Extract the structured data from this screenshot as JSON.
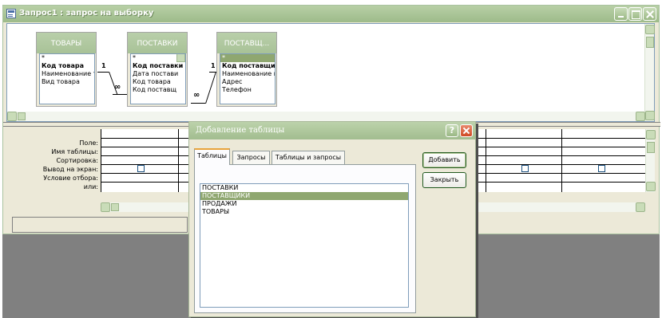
{
  "window": {
    "title": "Запрос1 : запрос на выборку"
  },
  "field_lists": [
    {
      "title": "ТОВАРЫ",
      "fields": [
        "*",
        "Код товара",
        "Наименование т",
        "Вид товара"
      ]
    },
    {
      "title": "ПОСТАВКИ",
      "fields": [
        "*",
        "Код поставки",
        "Дата постави",
        "Код товара",
        "Код поставщ"
      ]
    },
    {
      "title": "ПОСТАВЩ...",
      "fields": [
        "*",
        "Код поставщика",
        "Наименование п",
        "Адрес",
        "Телефон"
      ]
    }
  ],
  "relations": {
    "one": "1",
    "many": "∞"
  },
  "qbe": {
    "row_labels": [
      "Поле:",
      "Имя таблицы:",
      "Сортировка:",
      "Вывод на экран:",
      "Условие отбора:",
      "или:"
    ]
  },
  "dialog": {
    "title": "Добавление таблицы",
    "help": "?",
    "tabs": [
      "Таблицы",
      "Запросы",
      "Таблицы и запросы"
    ],
    "tables": [
      "ПОСТАВКИ",
      "ПОСТАВЩИКИ",
      "ПРОДАЖИ",
      "ТОВАРЫ"
    ],
    "selected_index": 1,
    "add_label": "Добавить",
    "close_label": "Закрыть"
  },
  "colors": {
    "titlebar": "#a8c297",
    "selection": "#8fa770",
    "dialog_close": "#d04a25"
  }
}
